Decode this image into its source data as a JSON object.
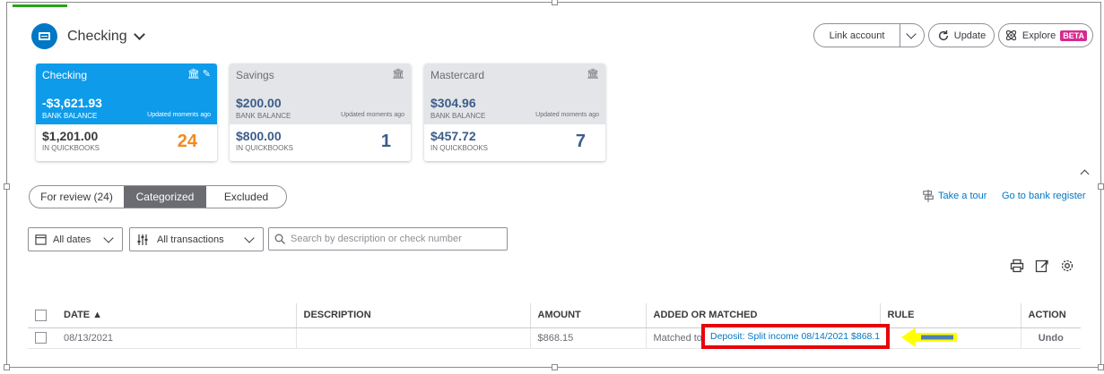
{
  "header": {
    "account_title": "Checking"
  },
  "top_actions": {
    "link_account": "Link account",
    "update": "Update",
    "explore": "Explore",
    "beta": "BETA"
  },
  "accounts": [
    {
      "name": "Checking",
      "bank_balance": "-$3,621.93",
      "bank_balance_label": "BANK BALANCE",
      "updated": "Updated moments ago",
      "qb_balance": "$1,201.00",
      "qb_label": "IN QUICKBOOKS",
      "count": "24",
      "active": true
    },
    {
      "name": "Savings",
      "bank_balance": "$200.00",
      "bank_balance_label": "BANK BALANCE",
      "updated": "Updated moments ago",
      "qb_balance": "$800.00",
      "qb_label": "IN QUICKBOOKS",
      "count": "1",
      "active": false
    },
    {
      "name": "Mastercard",
      "bank_balance": "$304.96",
      "bank_balance_label": "BANK BALANCE",
      "updated": "Updated moments ago",
      "qb_balance": "$457.72",
      "qb_label": "IN QUICKBOOKS",
      "count": "7",
      "active": false
    }
  ],
  "tabs": [
    {
      "label": "For review (24)"
    },
    {
      "label": "Categorized",
      "selected": true
    },
    {
      "label": "Excluded"
    }
  ],
  "links": {
    "take_tour": "Take a tour",
    "bank_register": "Go to bank register"
  },
  "filters": {
    "dates": "All dates",
    "transactions": "All transactions",
    "search_placeholder": "Search by description or check number"
  },
  "table": {
    "columns": [
      "DATE ▲",
      "DESCRIPTION",
      "AMOUNT",
      "ADDED OR MATCHED",
      "RULE",
      "ACTION"
    ],
    "rows": [
      {
        "date": "08/13/2021",
        "description": "",
        "amount": "$868.15",
        "matched_prefix": "Matched to",
        "matched_link": "Deposit: Split income 08/14/2021 $868.1",
        "rule": "",
        "action": "Undo"
      }
    ]
  },
  "colors": {
    "brand_blue": "#0077c5",
    "active_tile": "#0d9bea",
    "count_orange": "#f28a22",
    "annotation_red": "#e8000b",
    "annotation_yellow": "#ffff00",
    "beta_pink": "#d52b8f"
  }
}
